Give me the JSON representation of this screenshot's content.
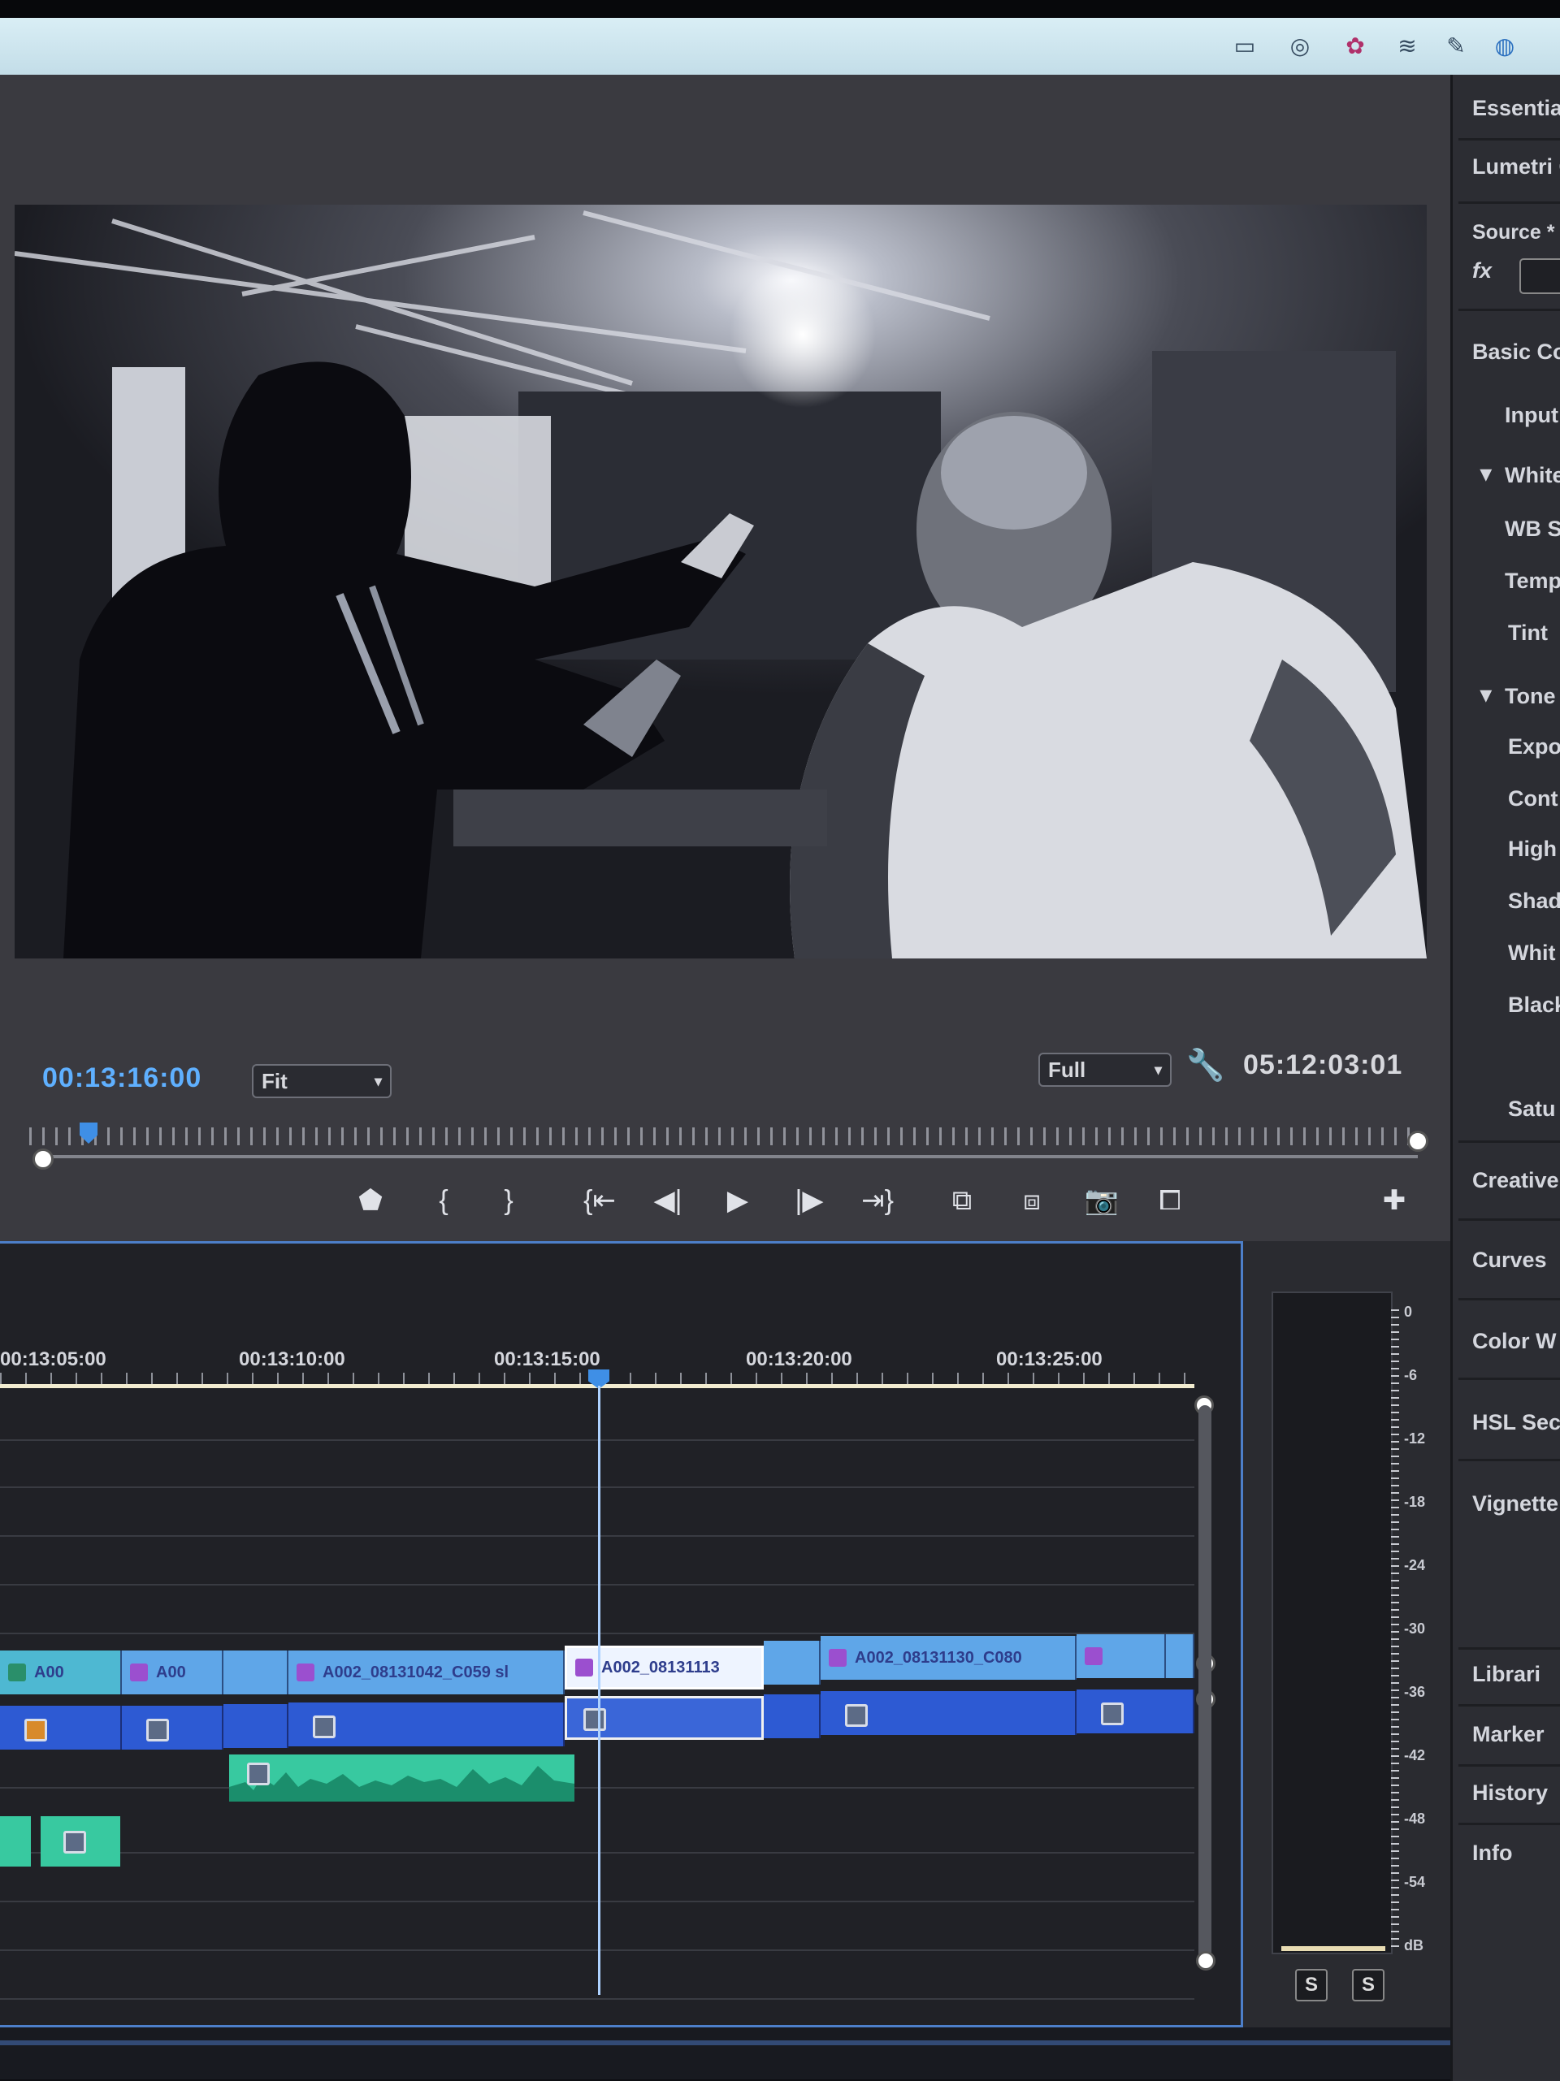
{
  "taskbar": {
    "icons": [
      "monitor-icon",
      "cloud-icon",
      "palette-icon",
      "stack-icon",
      "pen-icon",
      "globe-icon"
    ]
  },
  "program_monitor": {
    "playhead_timecode": "00:13:16:00",
    "zoom_select": "Fit",
    "resolution_select": "Full",
    "duration_timecode": "05:12:03:01",
    "controls": [
      "add-marker",
      "mark-in",
      "mark-out",
      "go-to-in",
      "step-back",
      "play",
      "step-forward",
      "go-to-out",
      "lift",
      "extract",
      "export-frame",
      "insert",
      "add"
    ]
  },
  "timeline": {
    "ruler": [
      "00:13:05:00",
      "00:13:10:00",
      "00:13:15:00",
      "00:13:20:00",
      "00:13:25:00"
    ],
    "video_clips": [
      "A00",
      "A00",
      "A002_08131042_C059 sl",
      "A002_08131113",
      "A002_08131130_C080"
    ]
  },
  "audio_meter": {
    "scale": [
      "0",
      "-6",
      "-12",
      "-18",
      "-24",
      "-30",
      "-36",
      "-42",
      "-48",
      "-54",
      "dB"
    ],
    "solo_buttons": [
      "S",
      "S"
    ]
  },
  "right_panel": {
    "items": [
      "Essential",
      "Lumetri C",
      "Source * A",
      "fx",
      "Basic Cor",
      "Input",
      "White",
      "WB Se",
      "Temp",
      "Tint",
      "Tone",
      "Expo",
      "Cont",
      "High",
      "Shad",
      "Whit",
      "Black",
      "Satu",
      "Creative",
      "Curves",
      "Color W",
      "HSL Sec",
      "Vignette",
      "Librari",
      "Marker",
      "History",
      "Info"
    ]
  }
}
